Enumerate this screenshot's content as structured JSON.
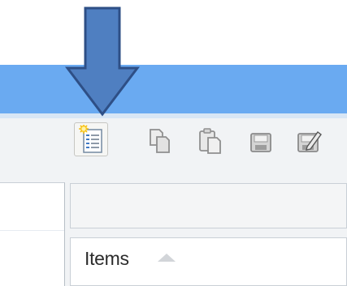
{
  "grid": {
    "columns": [
      {
        "label": "Items",
        "sort": "ascending"
      }
    ]
  },
  "toolbar": {
    "buttons": [
      {
        "icon": "new-document-icon",
        "state": "highlighted"
      },
      {
        "icon": "copy-icon",
        "state": "disabled"
      },
      {
        "icon": "paste-icon",
        "state": "disabled"
      },
      {
        "icon": "save-icon",
        "state": "disabled"
      },
      {
        "icon": "save-as-icon",
        "state": "disabled"
      }
    ]
  },
  "annotation": {
    "icon": "down-arrow-icon",
    "color": "#4f7fc1"
  },
  "colors": {
    "titlebar": "#6aaaf1",
    "window_background": "#f1f3f5"
  }
}
